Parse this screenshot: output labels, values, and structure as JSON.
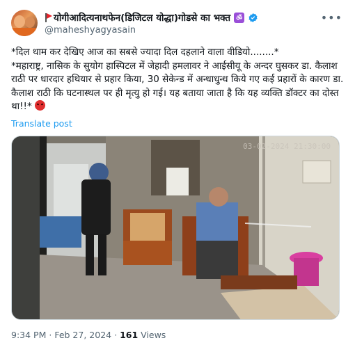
{
  "post": {
    "display_name": "योगीआदित्यनाथफेन(डिजिटल योद्धा)गोडसे का भक्त",
    "om_badge": "ॐ",
    "handle": "@maheshyagyasain",
    "text_line1": "*दिल थाम कर देखिए आज का सबसे ज्यादा दिल दहलाने वाला वीडियो........*",
    "text_line2": "*महाराष्ट्र, नासिक के सुयोग हास्पिटल में जेहादी हमलावर ने आईसीयू के अन्दर घुसकर डा. कैलाश राठी पर धारदार हथियार से प्रहार किया, 30 सेकेन्ड में अन्धाधुन्ध किये गए कई प्रहारों के कारण डा. कैलाश राठी कि घटनास्थल पर ही मृत्यु हो गई। यह बताया जाता है कि यह व्यक्ति डॉक्टर का दोस्त था!!*",
    "translate_label": "Translate post",
    "video_timestamp": "03-02-2024  21:30:00",
    "time": "9:34 PM",
    "date": "Feb 27, 2024",
    "views_count": "161",
    "views_label": "Views",
    "separator": "·"
  },
  "icons": {
    "flag": "flag-icon",
    "verified": "verified-badge-icon",
    "more": "more-options-icon",
    "angry": "angry-face-emoji"
  },
  "colors": {
    "link": "#1d9bf0",
    "secondary_text": "#536471",
    "primary_text": "#0f1419",
    "om_badge": "#9a4fd8"
  }
}
